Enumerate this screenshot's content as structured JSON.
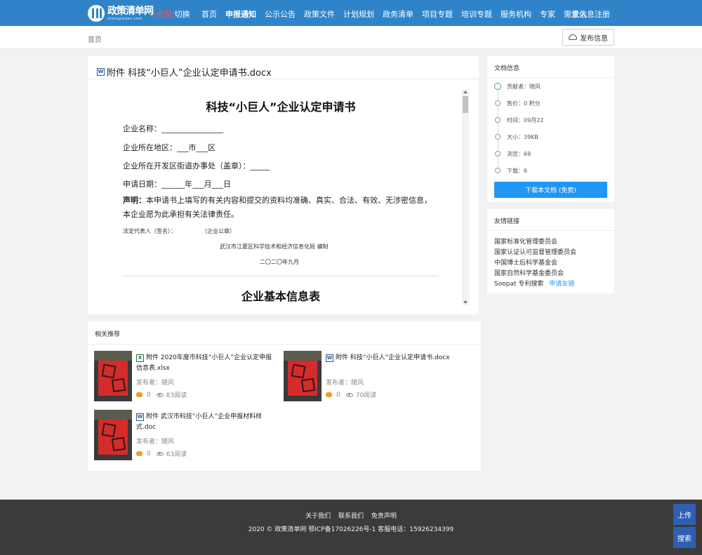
{
  "header": {
    "logo_name": "政策清单网",
    "logo_url": "zhengcedan.com",
    "region_tag": "[全国]",
    "region_switch": "切换",
    "nav": [
      "首页",
      "申报通知",
      "公示公告",
      "政策文件",
      "计划规划",
      "政务清单",
      "项目专题",
      "培训专题",
      "服务机构",
      "专家",
      "需求信息"
    ],
    "nav_active": 1,
    "login": "登入",
    "register": "注册"
  },
  "breadcrumb": {
    "home": "首页",
    "publish_button": "发布信息"
  },
  "document": {
    "title": "附件 科技“小巨人”企业认定申请书.docx",
    "file_icon": "W",
    "heading": "科技“小巨人”企业认定申请书",
    "fields": [
      "企业名称：________________",
      "企业所在地区：___市___区",
      "企业所在开发区街道办事处（盖章）：_____",
      "申请日期：______年___月___日"
    ],
    "declaration_label": "声明：",
    "declaration_text": "本申请书上填写的有关内容和提交的资料均准确、真实、合法、有效、无涉密信息，本企业愿为此承担有关法律责任。",
    "signature_left": "法定代表人（签名）：",
    "signature_right": "（企业公章）",
    "issuer": "武汉市江夏区科学技术和经济信息化局 编制",
    "date": "二〇二〇年九月",
    "section_heading": "企业基本信息表"
  },
  "doc_info": {
    "title": "文档信息",
    "items": [
      "贡献者：随风",
      "售价：0 积分",
      "时间：09月22",
      "大小：39KB",
      "浏览：69",
      "下载：6"
    ],
    "download_button": "下载本文档 (免费)"
  },
  "friend_links": {
    "title": "友情链接",
    "items": [
      "国家标准化管理委员会",
      "国家认证认可监督管理委员会",
      "中国博士后科学基金会",
      "国家自然科学基金委员会",
      "Soopat 专利搜索"
    ],
    "apply": "申请友链"
  },
  "related": {
    "title": "相关推荐",
    "cards": [
      {
        "icon": "X",
        "title": "附件 2020年度市科技“小巨人”企业认定申报信息表.xlsx",
        "publisher": "发布者：随风",
        "price": "0",
        "reads": "83阅读"
      },
      {
        "icon": "W",
        "title": "附件 科技“小巨人”企业认定申请书.docx",
        "publisher": "发布者：随风",
        "price": "0",
        "reads": "70阅读"
      },
      {
        "icon": "W",
        "title": "附件 武汉市科技“小巨人”企业申报材料样式.doc",
        "publisher": "发布者：随风",
        "price": "0",
        "reads": "63阅读"
      }
    ]
  },
  "footer": {
    "links": [
      "关于我们",
      "联系我们",
      "免责声明"
    ],
    "copyright": "2020 ©  政策清单网  鄂ICP备17026226号-1 客服电话：15926234399"
  },
  "float_buttons": {
    "upload": "上传",
    "search": "搜索"
  },
  "colors": {
    "brand": "#2f84c9",
    "download": "#2196f3",
    "footer": "#3b3b3b"
  }
}
